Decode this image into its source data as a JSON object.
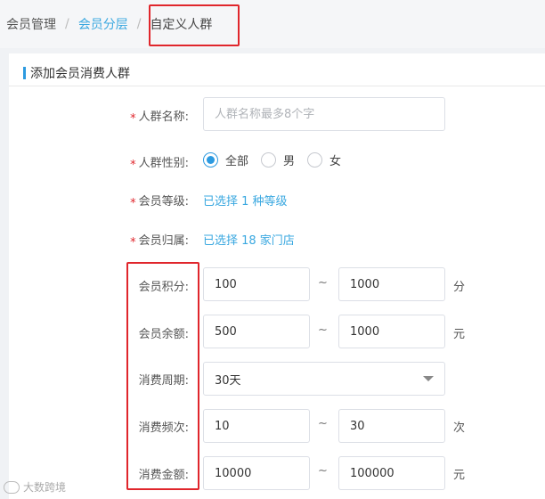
{
  "breadcrumb": {
    "items": [
      "会员管理",
      "会员分层",
      "自定义人群"
    ],
    "separator": "/"
  },
  "section": {
    "title": "添加会员消费人群"
  },
  "form": {
    "required_mark": "*",
    "name": {
      "label": "人群名称:",
      "placeholder": "人群名称最多8个字",
      "value": ""
    },
    "gender": {
      "label": "人群性别:",
      "options": [
        "全部",
        "男",
        "女"
      ],
      "selected": "全部"
    },
    "level": {
      "label": "会员等级:",
      "value": "已选择 1 种等级"
    },
    "belong": {
      "label": "会员归属:",
      "value": "已选择 18 家门店"
    },
    "range_separator": "~",
    "points": {
      "label": "会员积分:",
      "min": "100",
      "max": "1000",
      "unit": "分"
    },
    "balance": {
      "label": "会员余额:",
      "min": "500",
      "max": "1000",
      "unit": "元"
    },
    "period": {
      "label": "消费周期:",
      "selected": "30天"
    },
    "frequency": {
      "label": "消费频次:",
      "min": "10",
      "max": "30",
      "unit": "次"
    },
    "amount": {
      "label": "消费金额:",
      "min": "10000",
      "max": "100000",
      "unit": "元"
    }
  },
  "watermark": {
    "text": "大数跨境"
  },
  "colors": {
    "accent": "#2d9ae0",
    "link": "#3aa8e0",
    "highlight_box": "#e0262c",
    "required": "#e0262c"
  }
}
